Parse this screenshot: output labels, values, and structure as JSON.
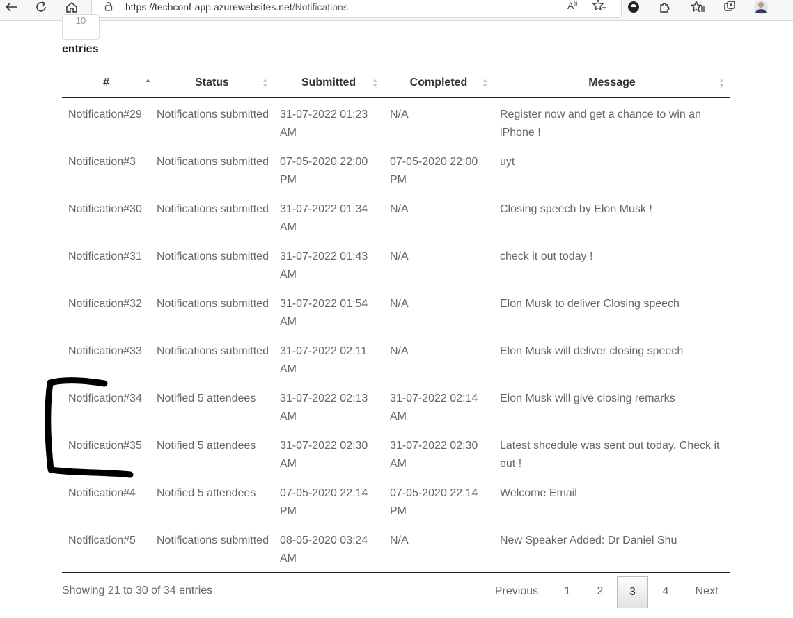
{
  "browser": {
    "url_host": "https://techconf-app.azurewebsites.net",
    "url_path": "/Notifications"
  },
  "length_select": {
    "value": "10"
  },
  "entries_label": "entries",
  "table": {
    "columns": [
      "#",
      "Status",
      "Submitted",
      "Completed",
      "Message"
    ],
    "rows": [
      [
        "Notification#29",
        "Notifications submitted",
        "31-07-2022 01:23 AM",
        "N/A",
        "Register now and get a chance to win an iPhone !"
      ],
      [
        "Notification#3",
        "Notifications submitted",
        "07-05-2020 22:00 PM",
        "07-05-2020 22:00 PM",
        "uyt"
      ],
      [
        "Notification#30",
        "Notifications submitted",
        "31-07-2022 01:34 AM",
        "N/A",
        "Closing speech by Elon Musk !"
      ],
      [
        "Notification#31",
        "Notifications submitted",
        "31-07-2022 01:43 AM",
        "N/A",
        "check it out today !"
      ],
      [
        "Notification#32",
        "Notifications submitted",
        "31-07-2022 01:54 AM",
        "N/A",
        "Elon Musk to deliver Closing speech"
      ],
      [
        "Notification#33",
        "Notifications submitted",
        "31-07-2022 02:11 AM",
        "N/A",
        "Elon Musk will deliver closing speech"
      ],
      [
        "Notification#34",
        "Notified 5 attendees",
        "31-07-2022 02:13 AM",
        "31-07-2022 02:14 AM",
        "Elon Musk will give closing remarks"
      ],
      [
        "Notification#35",
        "Notified 5 attendees",
        "31-07-2022 02:30 AM",
        "31-07-2022 02:30 AM",
        "Latest shcedule was sent out today. Check it out !"
      ],
      [
        "Notification#4",
        "Notified 5 attendees",
        "07-05-2020 22:14 PM",
        "07-05-2020 22:14 PM",
        "Welcome Email"
      ],
      [
        "Notification#5",
        "Notifications submitted",
        "08-05-2020 03:24 AM",
        "N/A",
        "New Speaker Added: Dr Daniel Shu"
      ]
    ]
  },
  "info": "Showing 21 to 30 of 34 entries",
  "pagination": {
    "previous": "Previous",
    "pages": [
      "1",
      "2",
      "3",
      "4"
    ],
    "current": "3",
    "next": "Next"
  },
  "colors": {
    "sort_active": "#5a73c4",
    "annotation": "#000000"
  }
}
